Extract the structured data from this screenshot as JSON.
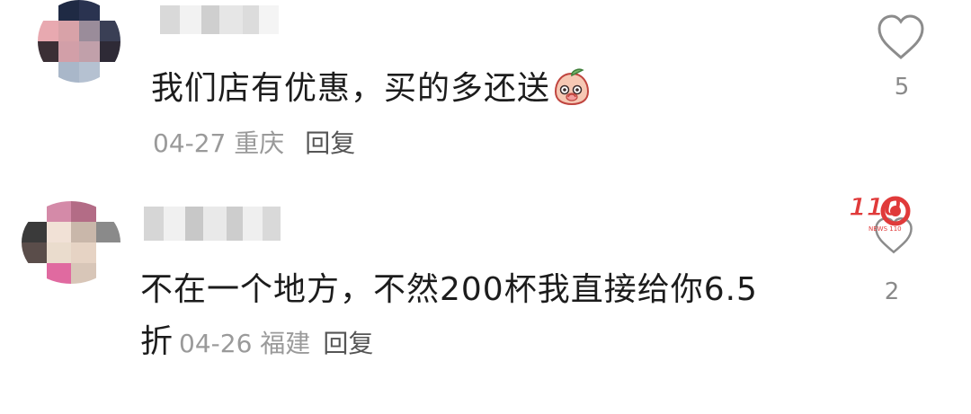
{
  "comments": [
    {
      "text": "我们店有优惠，买的多还送",
      "emoji": "peach-face-emoji",
      "date": "04-27",
      "location": "重庆",
      "reply_label": "回复",
      "likes": "5",
      "avatar_colors": [
        "#ffffff",
        "#1f2a44",
        "#2a3350",
        "#ffffff",
        "#e8a9b0",
        "#d8a2a8",
        "#9a8c9a",
        "#3a3f55",
        "#3b2f35",
        "#d29fa8",
        "#c1a0aa",
        "#2e2a36",
        "#ffffff",
        "#a9b7c9",
        "#b5c1d1",
        "#ffffff"
      ],
      "username_blocks": [
        "#d9d9d9",
        "#f2f2f2",
        "#cfcfcf",
        "#e6e6e6",
        "#dcdcdc",
        "#f4f4f4"
      ]
    },
    {
      "text_line1": "不在一个地方，不然200杯我直接给你6.5",
      "text_line2": "折",
      "date": "04-26",
      "location": "福建",
      "reply_label": "回复",
      "likes": "2",
      "avatar_colors": [
        "#ffffff",
        "#d48aa8",
        "#b36c86",
        "#ffffff",
        "#3a3a3a",
        "#f1e1d6",
        "#c9b7aa",
        "#8a8a8a",
        "#5a4d4a",
        "#eadccd",
        "#e6d3c4",
        "#ffffff",
        "#ffffff",
        "#e06aa0",
        "#d8c6b8",
        "#ffffff"
      ],
      "username_blocks": [
        "#d6d6d6",
        "#f0f0f0",
        "#c8c8c8",
        "#e9e9e9",
        "#cdcdcd",
        "#efefef",
        "#d9d9d9"
      ]
    }
  ],
  "watermark": {
    "text": "新闻110",
    "subtext": "NEWS 110",
    "color": "#e03a3a"
  }
}
